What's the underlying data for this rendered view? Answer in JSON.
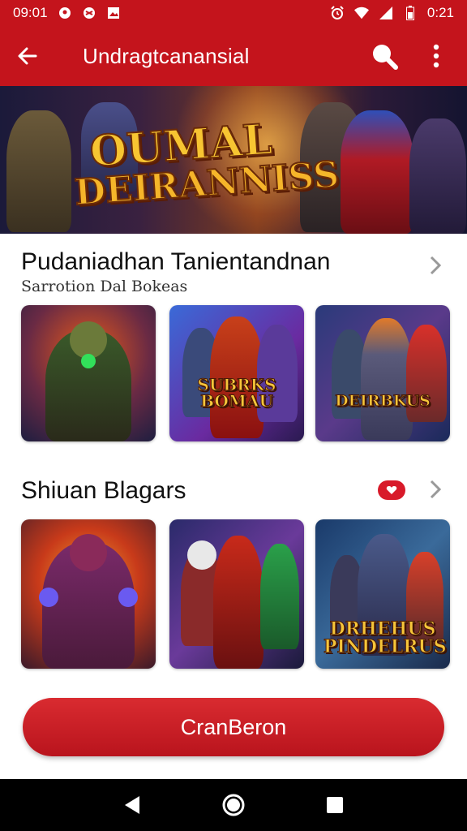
{
  "status_bar": {
    "time_left": "09:01",
    "time_right": "0:21",
    "icons_left": [
      "location-icon",
      "game-controller-icon",
      "image-icon"
    ],
    "icons_right": [
      "alarm-icon",
      "wifi-icon",
      "signal-icon",
      "battery-icon"
    ]
  },
  "app_bar": {
    "title": "Undragtcanansial",
    "icons": [
      "back-arrow-icon",
      "search-icon",
      "more-vert-icon"
    ]
  },
  "banner": {
    "logo_line1": "OUMAL",
    "logo_line2": "DEIRANNISS"
  },
  "section1": {
    "title": "Pudaniadhan Tanientandnan",
    "subtitle": "Sarrotion Dal Bokeas",
    "cards": [
      {
        "caption": "",
        "tag": ""
      },
      {
        "caption": "SUBRKS BOMAU",
        "tag": ""
      },
      {
        "caption": "DEIRBKUS",
        "tag": ""
      }
    ]
  },
  "section2": {
    "title": "Shiuan Blagars",
    "cards": [
      {
        "caption": "",
        "tag": ""
      },
      {
        "caption": "",
        "tag": ""
      },
      {
        "caption": "DRHEHUS PINDELRUS",
        "tag": ""
      }
    ]
  },
  "cta": {
    "label": "CranBeron"
  },
  "nav": {
    "icons": [
      "back-triangle-icon",
      "home-circle-icon",
      "recents-square-icon"
    ]
  },
  "colors": {
    "brand_red": "#c4141c",
    "button_red": "#d92b30",
    "logo_gold": "#f7c532"
  }
}
